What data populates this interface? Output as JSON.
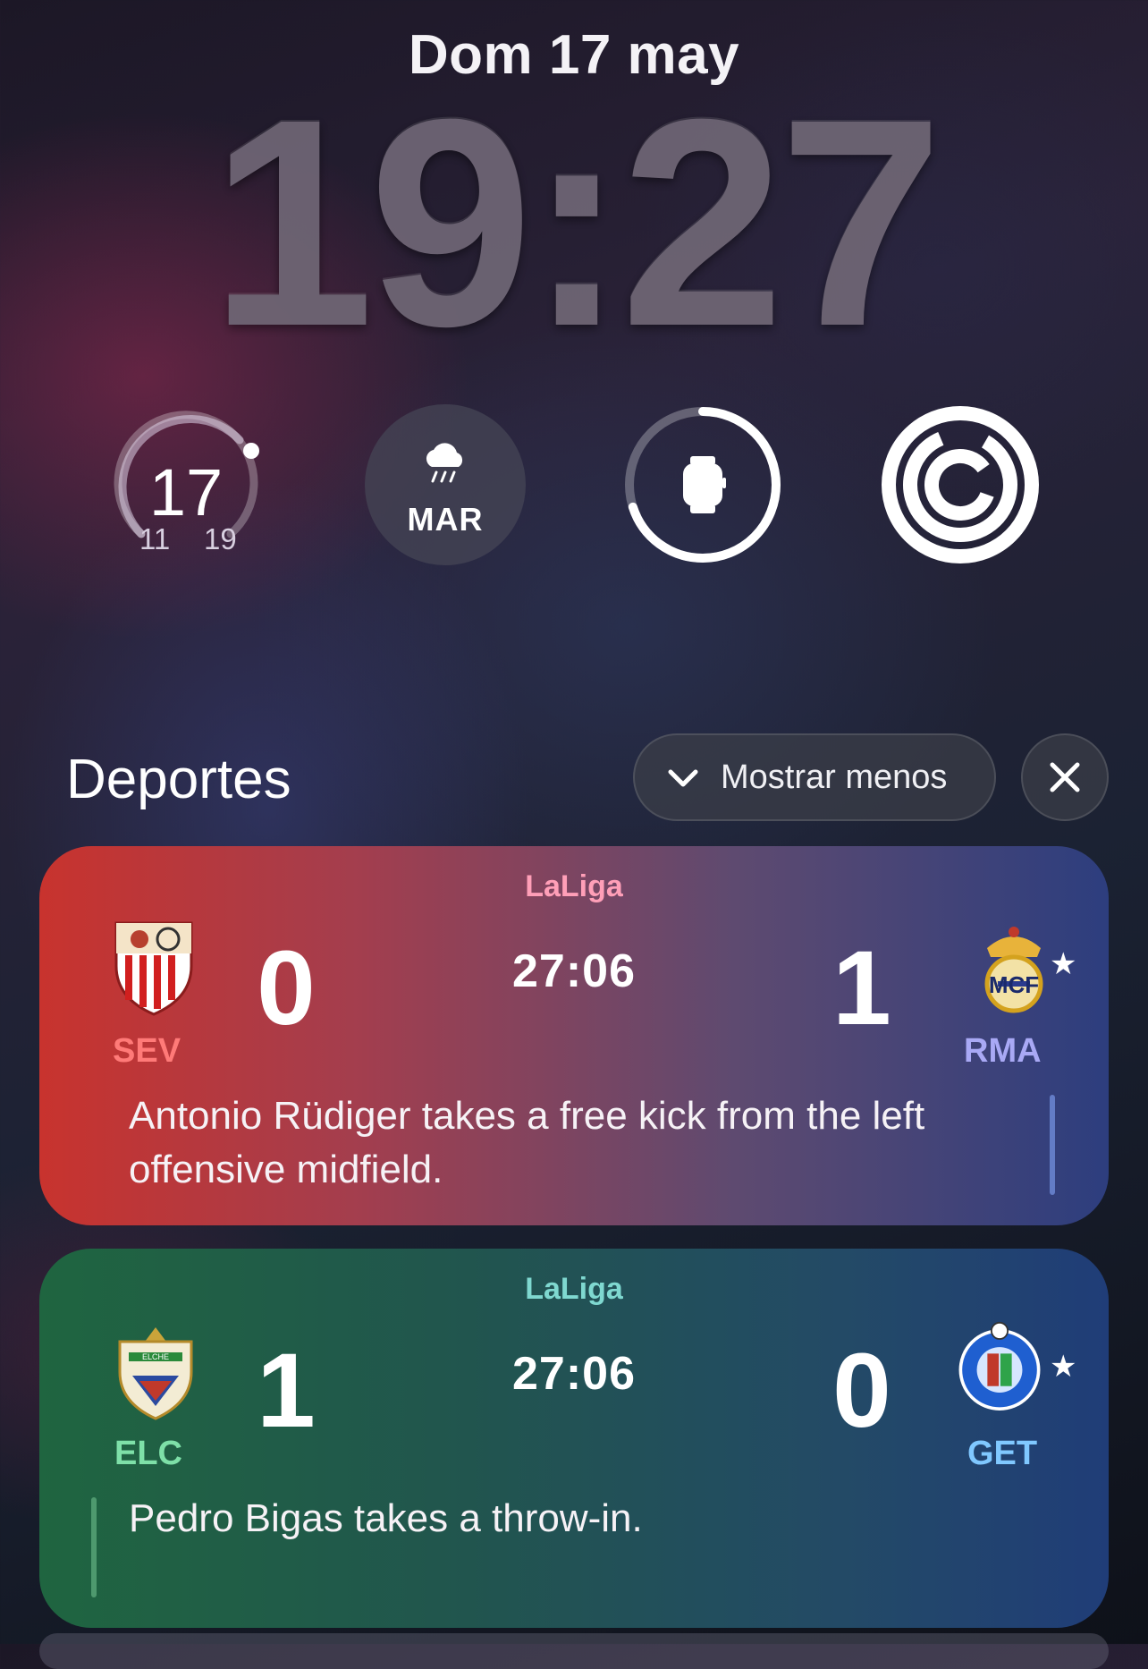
{
  "lockscreen": {
    "date": "Dom 17 may",
    "time": "19:27"
  },
  "widgets": {
    "temperature": {
      "current": "17",
      "low": "11",
      "high": "19",
      "level": 0.75
    },
    "weather": {
      "icon": "rain-cloud-icon",
      "day": "MAR"
    },
    "watch_battery": {
      "icon": "watch-icon",
      "level": 0.7
    },
    "activity": {
      "icon": "activity-rings-icon"
    }
  },
  "notifications": {
    "title": "Deportes",
    "show_less_label": "Mostrar menos",
    "close_icon": "close-icon",
    "cards": [
      {
        "league": "LaLiga",
        "clock": "27:06",
        "home": {
          "abbr": "SEV",
          "score": "0",
          "crest": "sevilla-crest-icon",
          "color": "#ff7a78"
        },
        "away": {
          "abbr": "RMA",
          "score": "1",
          "crest": "real-madrid-crest-icon",
          "color": "#a9a9f5"
        },
        "favorite": "★",
        "description": "Antonio Rüdiger takes a free kick from the left offensive midfield.",
        "league_color": "#ff9fb8"
      },
      {
        "league": "LaLiga",
        "clock": "27:06",
        "home": {
          "abbr": "ELC",
          "score": "1",
          "crest": "elche-crest-icon",
          "color": "#7ee0a8"
        },
        "away": {
          "abbr": "GET",
          "score": "0",
          "crest": "getafe-crest-icon",
          "color": "#80c8ff"
        },
        "favorite": "★",
        "description": "Pedro Bigas takes a throw-in.",
        "league_color": "#7fd8d0"
      }
    ]
  }
}
